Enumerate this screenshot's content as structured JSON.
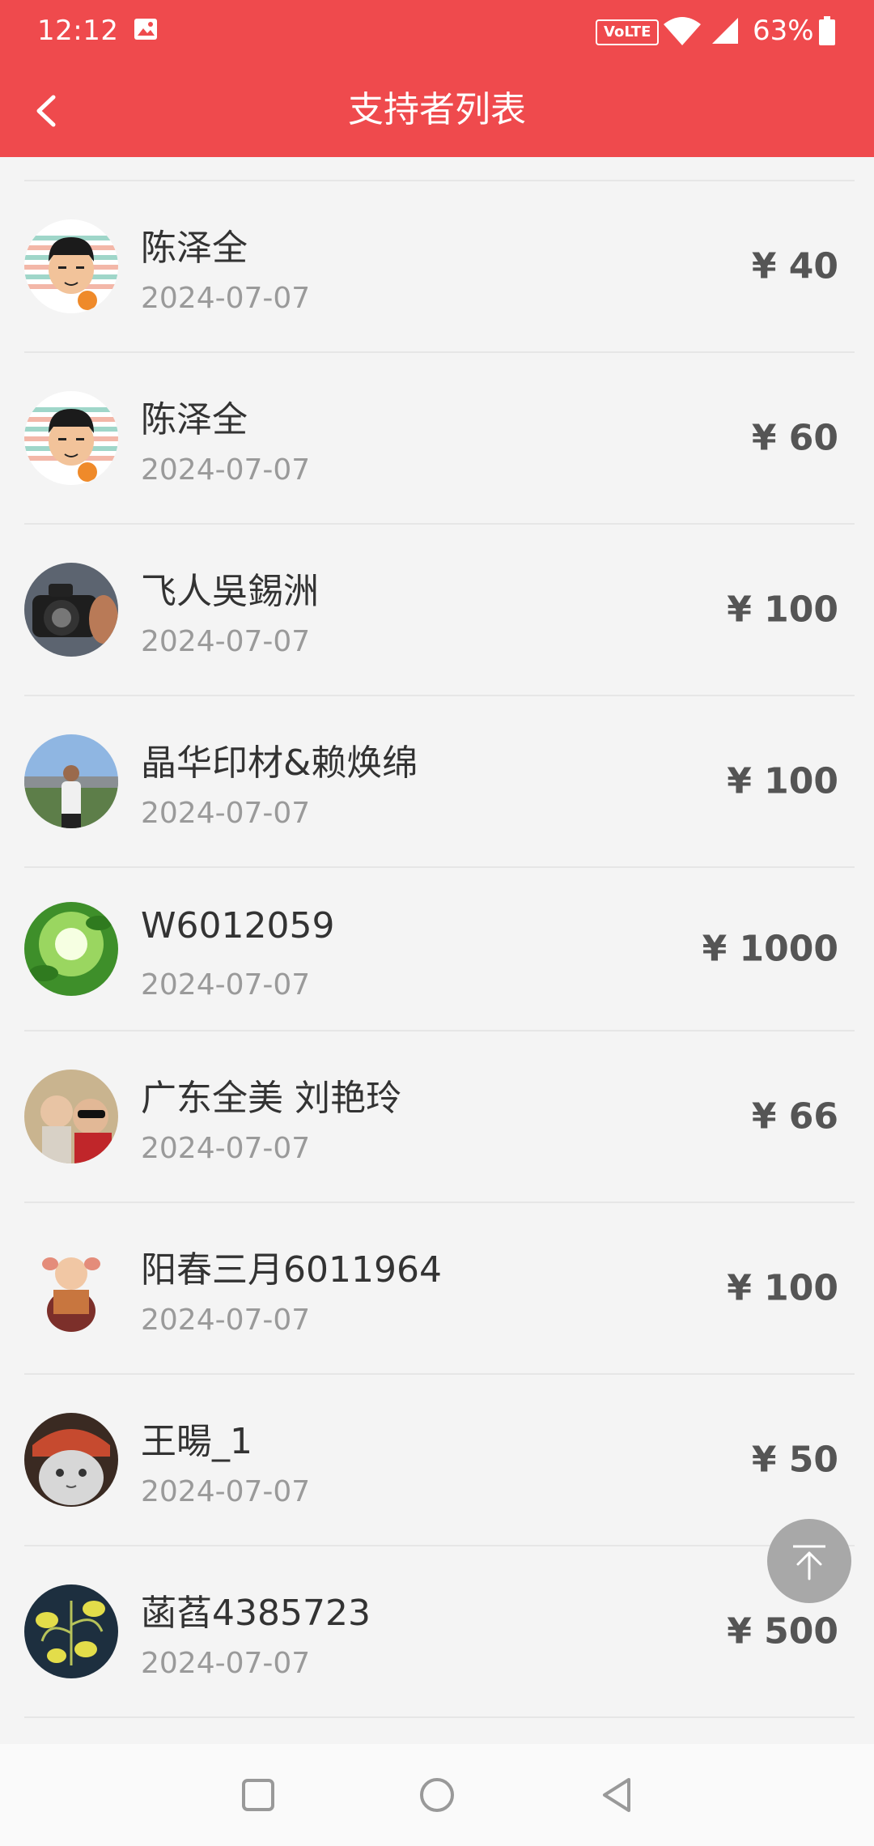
{
  "status_bar": {
    "time": "12:12",
    "volte": "VoLTE",
    "battery_pct": "63%"
  },
  "header": {
    "title": "支持者列表"
  },
  "supporters": [
    {
      "name": "陈泽全",
      "date": "2024-07-07",
      "amount": "¥ 40",
      "avatar": "cartoon-boy-basketball"
    },
    {
      "name": "陈泽全",
      "date": "2024-07-07",
      "amount": "¥ 60",
      "avatar": "cartoon-boy-basketball"
    },
    {
      "name": "飞人吳錫洲",
      "date": "2024-07-07",
      "amount": "¥ 100",
      "avatar": "camera-photo"
    },
    {
      "name": "晶华印材&赖焕绵",
      "date": "2024-07-07",
      "amount": "¥ 100",
      "avatar": "man-outdoor-photo"
    },
    {
      "name": "W6012059",
      "date": "2024-07-07",
      "amount": "¥ 1000",
      "avatar": "green-leaves-sunlight"
    },
    {
      "name": "广东全美 刘艳玲",
      "date": "2024-07-07",
      "amount": "¥ 66",
      "avatar": "family-selfie-photo"
    },
    {
      "name": "阳春三月6011964",
      "date": "2024-07-07",
      "amount": "¥ 100",
      "avatar": "cartoon-girl-pigtails"
    },
    {
      "name": "王暘_1",
      "date": "2024-07-07",
      "amount": "¥ 50",
      "avatar": "cat-photo"
    },
    {
      "name": "菡萏4385723",
      "date": "2024-07-07",
      "amount": "¥ 500",
      "avatar": "yellow-flower-dark"
    }
  ],
  "colors": {
    "header_bg": "#ef4a4d",
    "page_bg": "#f4f4f4",
    "amount_text": "#555555",
    "date_text": "#9a9a9a"
  }
}
